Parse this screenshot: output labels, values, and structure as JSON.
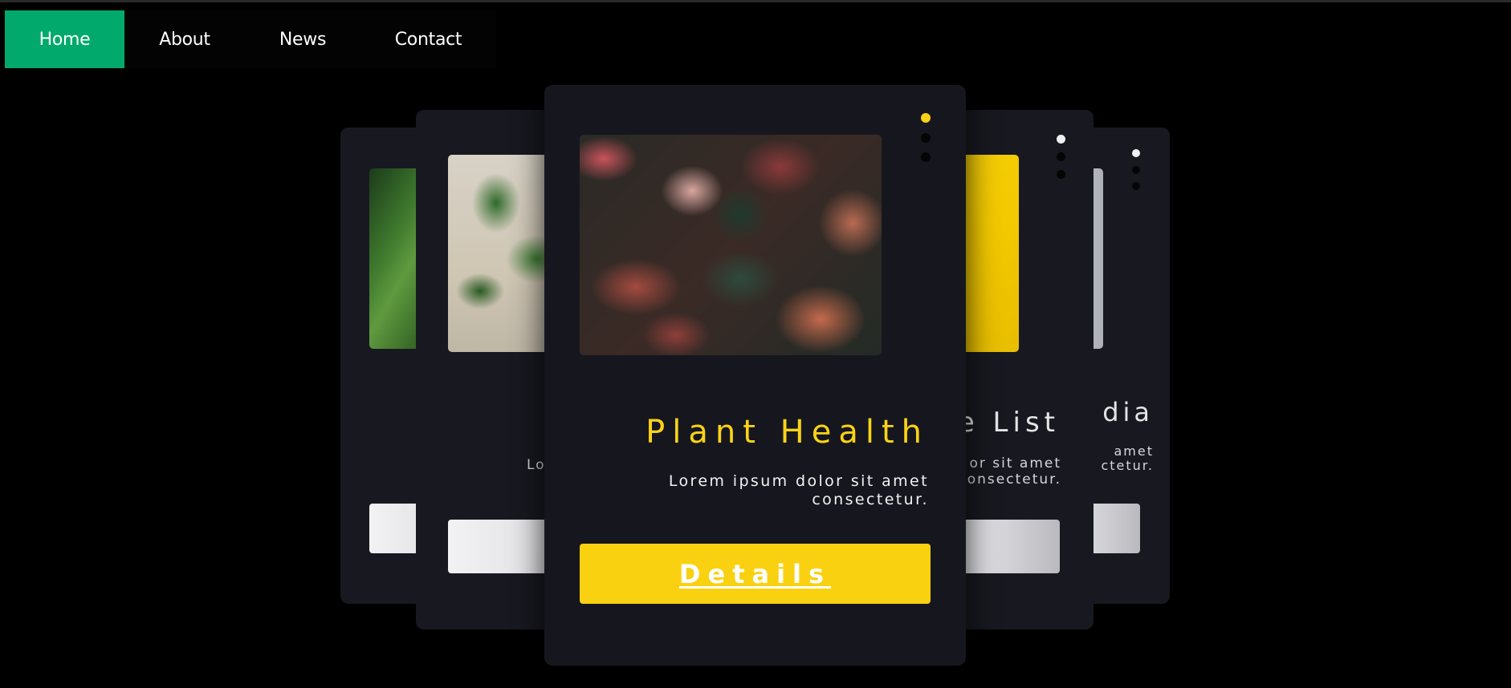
{
  "nav": {
    "items": [
      {
        "label": "Home",
        "active": true
      },
      {
        "label": "About",
        "active": false
      },
      {
        "label": "News",
        "active": false
      },
      {
        "label": "Contact",
        "active": false
      }
    ]
  },
  "cards": {
    "center": {
      "title": "Plant Health",
      "text_line1": "Lorem ipsum dolor sit amet",
      "text_line2": "consectetur.",
      "button_label": "Details",
      "image": "colorful-leaves"
    },
    "left": {
      "text_fragment": "Lo",
      "image": "potted-houseplants"
    },
    "far_left": {
      "image": "green-leaf-closeup"
    },
    "right": {
      "title_fragment": "e List",
      "text_line1": "or sit amet",
      "text_line2": "onsectetur.",
      "image": "cactus-on-yellow"
    },
    "far_right": {
      "title_fragment": "dia",
      "text_line1": "amet",
      "text_line2": "ctetur.",
      "image": "grey-panel"
    }
  },
  "colors": {
    "accent_green": "#02a96d",
    "accent_yellow": "#f9d110",
    "card_bg": "#181920",
    "page_bg": "#000000"
  }
}
